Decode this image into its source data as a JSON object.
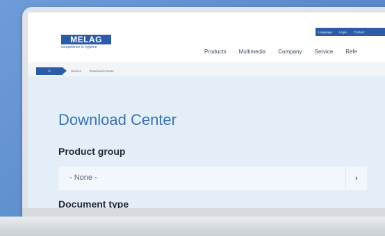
{
  "brand": {
    "logo_text": "MELAG",
    "tagline": "competence in hygiene",
    "color": "#2c5ba8"
  },
  "utility_nav": [
    "Language",
    "Login",
    "Contact"
  ],
  "main_nav": [
    "Products",
    "Multimedia",
    "Company",
    "Service",
    "Refe"
  ],
  "breadcrumb": {
    "home_icon": "home-icon",
    "items": [
      "Service",
      "Download Center"
    ]
  },
  "page": {
    "title": "Download Center",
    "product_group_label": "Product group",
    "product_group_value": "- None -",
    "document_type_label": "Document type"
  }
}
